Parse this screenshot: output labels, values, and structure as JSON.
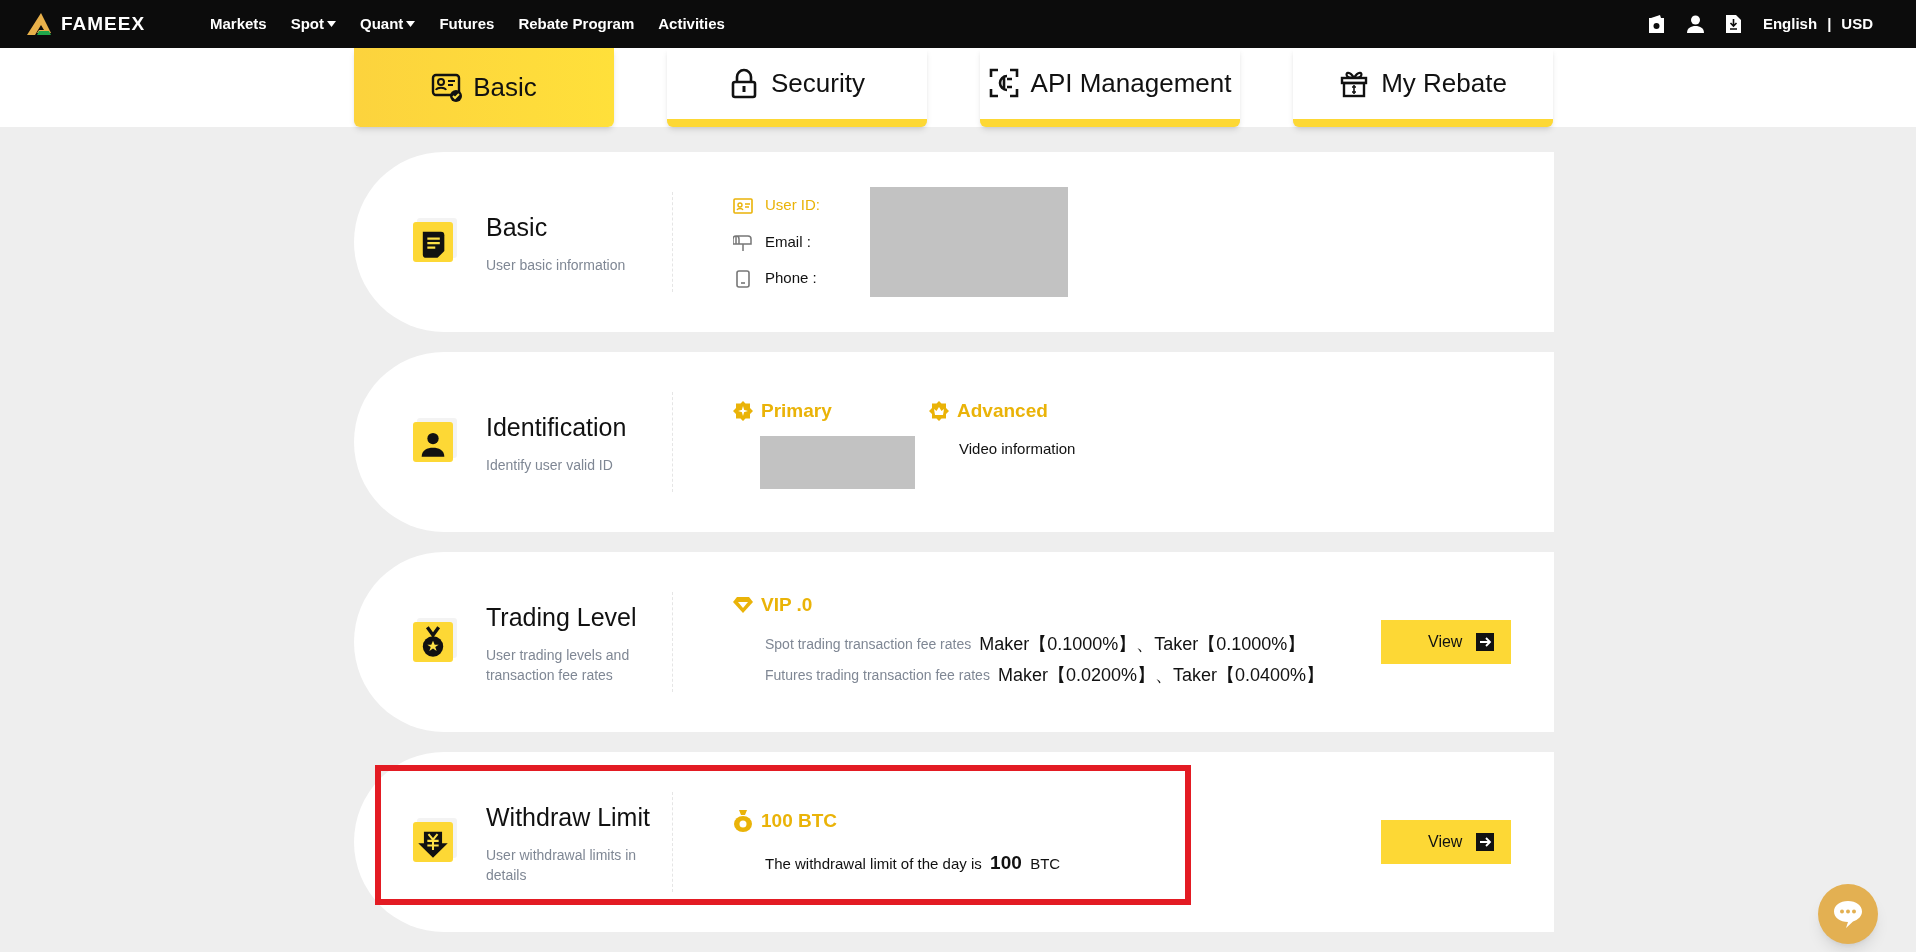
{
  "nav": {
    "logo": "FAMEEX",
    "links": [
      {
        "label": "Markets",
        "dropdown": false
      },
      {
        "label": "Spot",
        "dropdown": true
      },
      {
        "label": "Quant",
        "dropdown": true
      },
      {
        "label": "Futures",
        "dropdown": false
      },
      {
        "label": "Rebate Program",
        "dropdown": false
      },
      {
        "label": "Activities",
        "dropdown": false
      }
    ],
    "language": "English",
    "separator": "|",
    "currency": "USD"
  },
  "tabs": [
    {
      "label": "Basic",
      "selected": true,
      "kind": "basic"
    },
    {
      "label": "Security",
      "selected": false,
      "kind": "security"
    },
    {
      "label": "API Management",
      "selected": false,
      "kind": "api"
    },
    {
      "label": "My Rebate",
      "selected": false,
      "kind": "rebate"
    }
  ],
  "sections": [
    {
      "kind": "basic",
      "title": "Basic",
      "subtitle": "User basic information",
      "highlighted": false,
      "fields": [
        {
          "kind": "id",
          "label": "User ID:",
          "active": true
        },
        {
          "kind": "email",
          "label": "Email :",
          "active": false
        },
        {
          "kind": "phone",
          "label": "Phone :",
          "active": false
        }
      ]
    },
    {
      "kind": "identification",
      "title": "Identification",
      "subtitle": "Identify user valid ID",
      "highlighted": false,
      "levels": [
        {
          "kind": "primary",
          "label": "Primary"
        },
        {
          "kind": "advanced",
          "label": "Advanced",
          "note": "Video information"
        }
      ]
    },
    {
      "kind": "trading",
      "title": "Trading Level",
      "subtitle": "User trading levels and transaction fee rates",
      "highlighted": false,
      "level": "VIP .0",
      "rates": [
        {
          "label": "Spot trading transaction fee rates",
          "value": "Maker【0.1000%】、Taker【0.1000%】"
        },
        {
          "label": "Futures trading transaction fee rates",
          "value": "Maker【0.0200%】、Taker【0.0400%】"
        }
      ],
      "button": "View"
    },
    {
      "kind": "withdraw",
      "title": "Withdraw Limit",
      "subtitle": "User withdrawal limits in details",
      "highlighted": true,
      "amount": "100 BTC",
      "sentence": "The withdrawal limit of the day is  **100**  BTC",
      "button": "View"
    }
  ]
}
